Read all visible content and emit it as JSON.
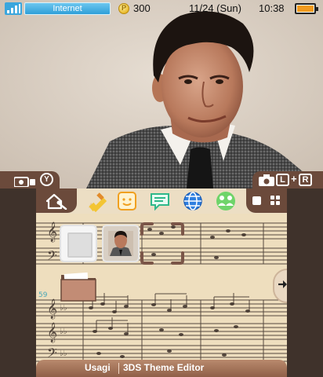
{
  "status_bar": {
    "network_label": "Internet",
    "coins": "300",
    "date": "11/24 (Sun)",
    "time": "10:38",
    "signal_icon": "signal-bars-icon",
    "battery_icon": "battery-icon"
  },
  "top_screen": {
    "background": "portrait-photo",
    "left_shoulder_buttons": [
      "camera-icon",
      "Y"
    ],
    "right_shoulder_buttons": [
      "camera-icon",
      "L",
      "+",
      "R"
    ]
  },
  "home_menu": {
    "toolbar_apps": [
      "settings-icon",
      "pencil-icon",
      "smiley-icon",
      "speech-bubble-icon",
      "globe-icon",
      "people-icon"
    ],
    "grid": [
      {
        "type": "empty-slot"
      },
      {
        "type": "photo-slot"
      },
      {
        "type": "selected-empty-slot"
      },
      {
        "type": "folder"
      }
    ],
    "page_counter": "59"
  },
  "bottom_bar": {
    "author": "Usagi",
    "app_name": "3DS Theme Editor"
  },
  "colors": {
    "frame_brown": "#6b4a3b",
    "bottom_bar": "#9c6b53",
    "internet_blue": "#3aa6dd",
    "battery_orange": "#f29a1e",
    "parchment": "#f0e2c4"
  }
}
